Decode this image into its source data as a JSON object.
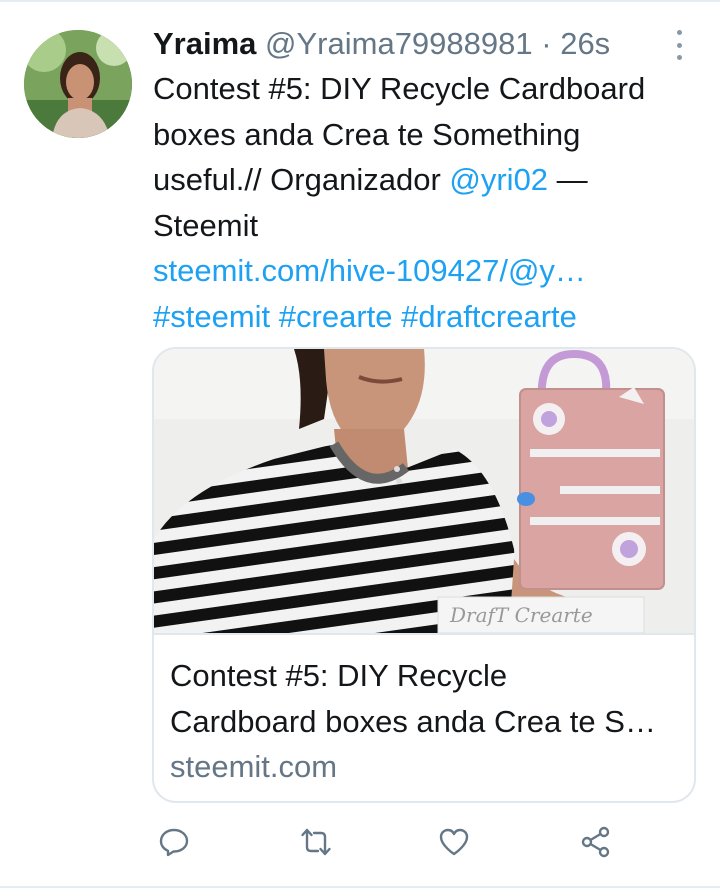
{
  "tweet": {
    "display_name": "Yraima",
    "handle": "@Yraima79988981",
    "separator": "·",
    "time": "26s",
    "text_line1": "Contest #5: DIY Recycle Cardboard",
    "text_line2": "boxes  anda Crea te Something",
    "text_line3_a": "useful.// Organizador ",
    "mention": "@yri02",
    "text_line3_b": " —",
    "text_line4": "Steemit",
    "link": "steemit.com/hive-109427/@y…",
    "hashtags": [
      "#steemit",
      "#crearte",
      "#draftcrearte"
    ]
  },
  "card": {
    "image_caption": "DrafT Crearte",
    "title_line1": "Contest #5: DIY Recycle",
    "title_line2": "Cardboard boxes anda Crea te S…",
    "domain": "steemit.com"
  },
  "icons": {
    "more": "more-vertical-icon",
    "reply": "reply-icon",
    "retweet": "retweet-icon",
    "like": "heart-icon",
    "share": "share-icon"
  },
  "colors": {
    "link": "#1da1f2",
    "secondary_text": "#657786",
    "icon": "#657786",
    "border": "#e1e8ed"
  }
}
